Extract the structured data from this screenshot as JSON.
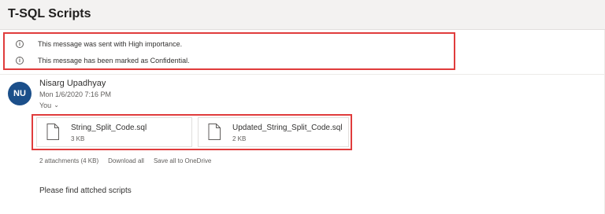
{
  "message": {
    "subject": "T-SQL Scripts",
    "notices": [
      {
        "icon": "info-icon",
        "text": "This message was sent with High importance."
      },
      {
        "icon": "info-icon",
        "text": "This message has been marked as Confidential."
      }
    ],
    "sender": {
      "initials": "NU",
      "name": "Nisarg Upadhyay",
      "date": "Mon 1/6/2020 7:16 PM",
      "to": "You",
      "avatar_color": "#1b4f8a"
    },
    "attachments": [
      {
        "name": "String_Split_Code.sql",
        "size": "3 KB",
        "icon": "file-icon"
      },
      {
        "name": "Updated_String_Split_Code.sql",
        "size": "2 KB",
        "icon": "file-icon"
      }
    ],
    "attachment_summary": "2 attachments (4 KB)",
    "download_all": "Download all",
    "save_all": "Save all to OneDrive",
    "body": "Please find attched scripts",
    "highlight_color": "#e03c3c"
  }
}
